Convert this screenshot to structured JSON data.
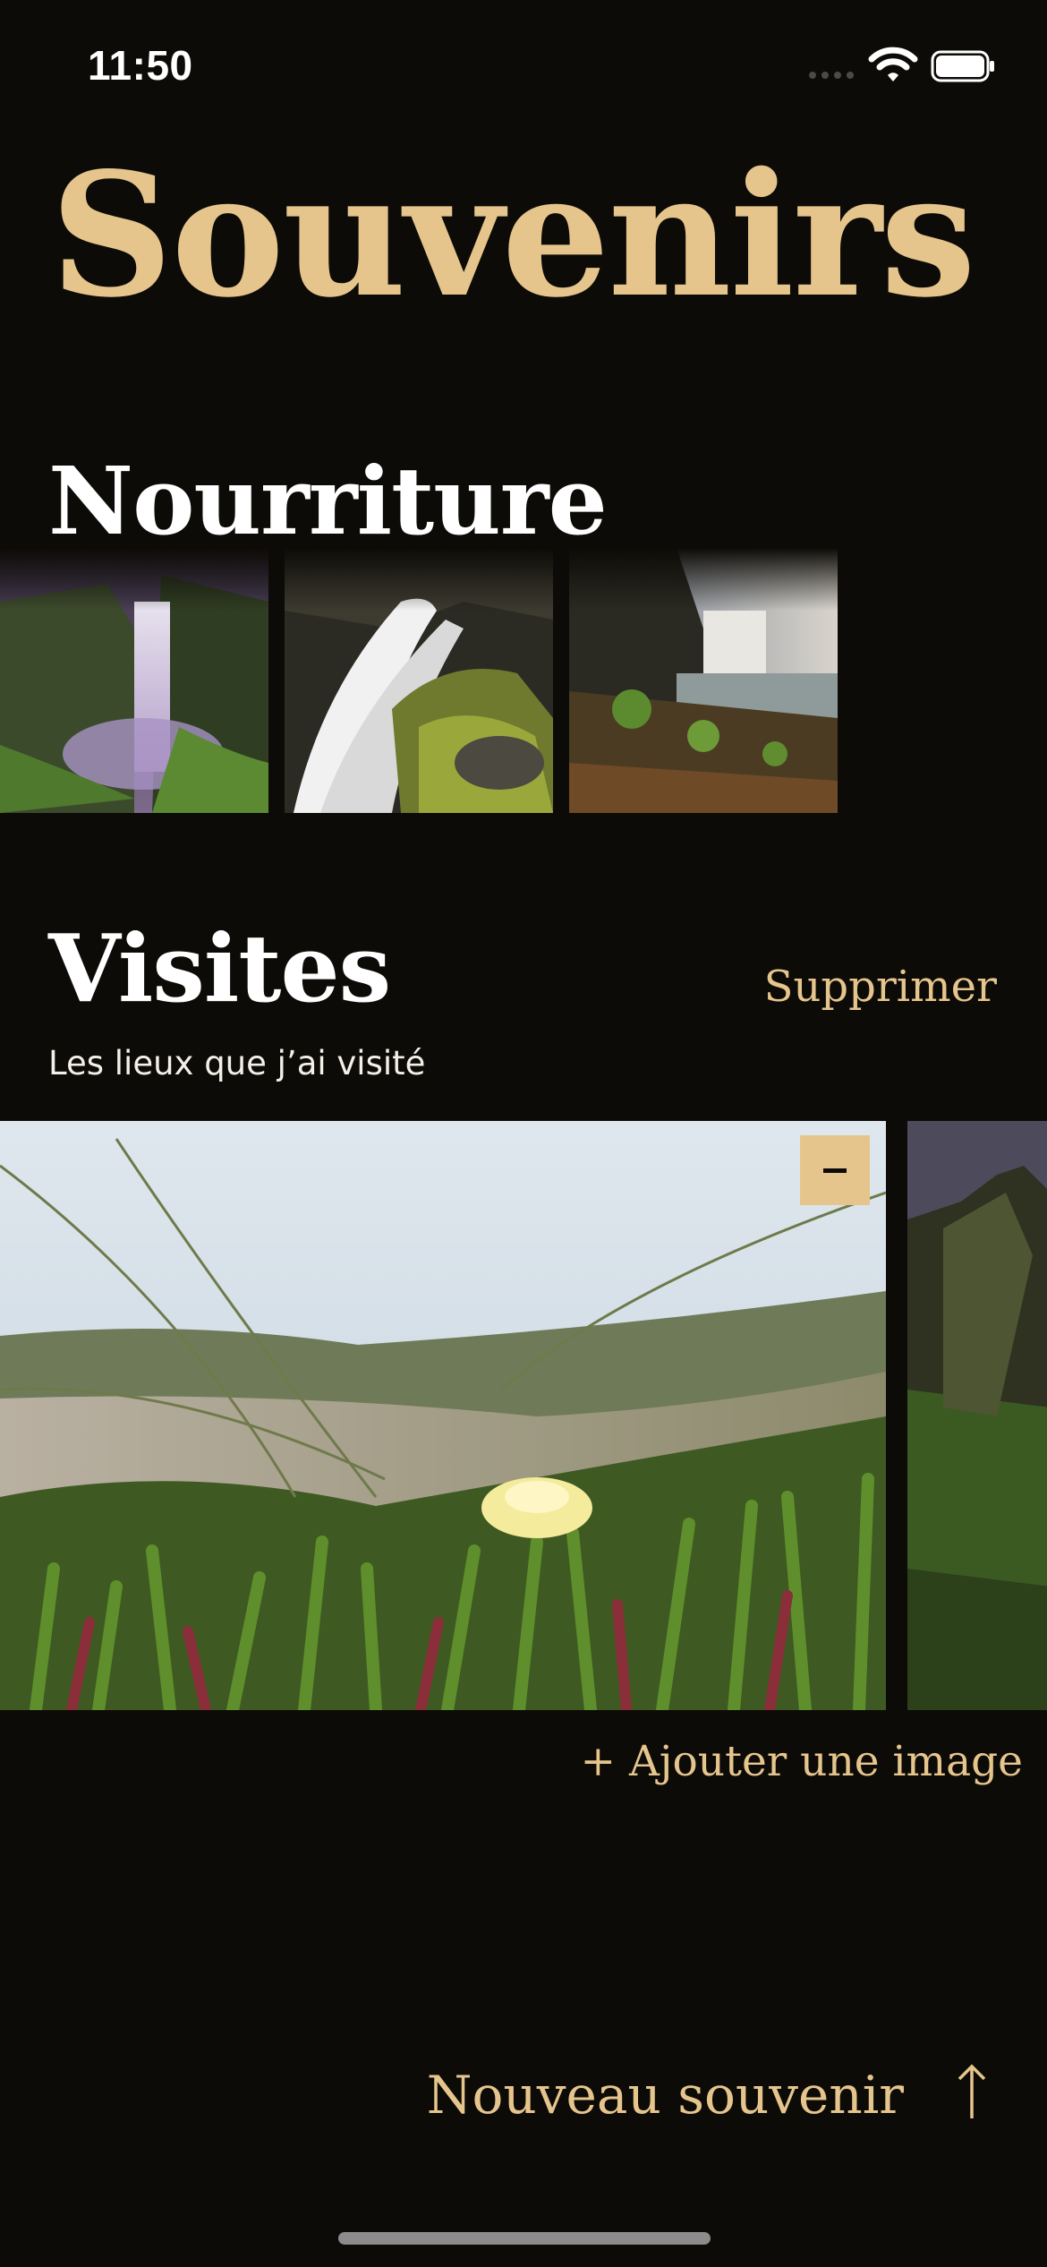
{
  "status": {
    "time": "11:50",
    "signal_icon": "cellular-signal-icon",
    "wifi_icon": "wifi-icon",
    "battery_icon": "battery-icon"
  },
  "app": {
    "title": "Souvenirs",
    "accent_color": "#e6c58d",
    "background_color": "#0d0b07"
  },
  "sections": [
    {
      "title": "Nourriture",
      "images": [
        "waterfall-photo",
        "waterfall-closeup-photo",
        "waterfall-coast-photo"
      ]
    },
    {
      "title": "Visites",
      "subtitle": "Les lieux que j’ai visité",
      "delete_label": "Supprimer",
      "remove_icon": "minus-icon",
      "images": [
        "beach-flower-photo",
        "rock-cliff-photo"
      ],
      "add_image_label": "+ Ajouter une image"
    }
  ],
  "footer": {
    "new_memory_label": "Nouveau souvenir",
    "arrow_icon": "arrow-up-icon"
  }
}
